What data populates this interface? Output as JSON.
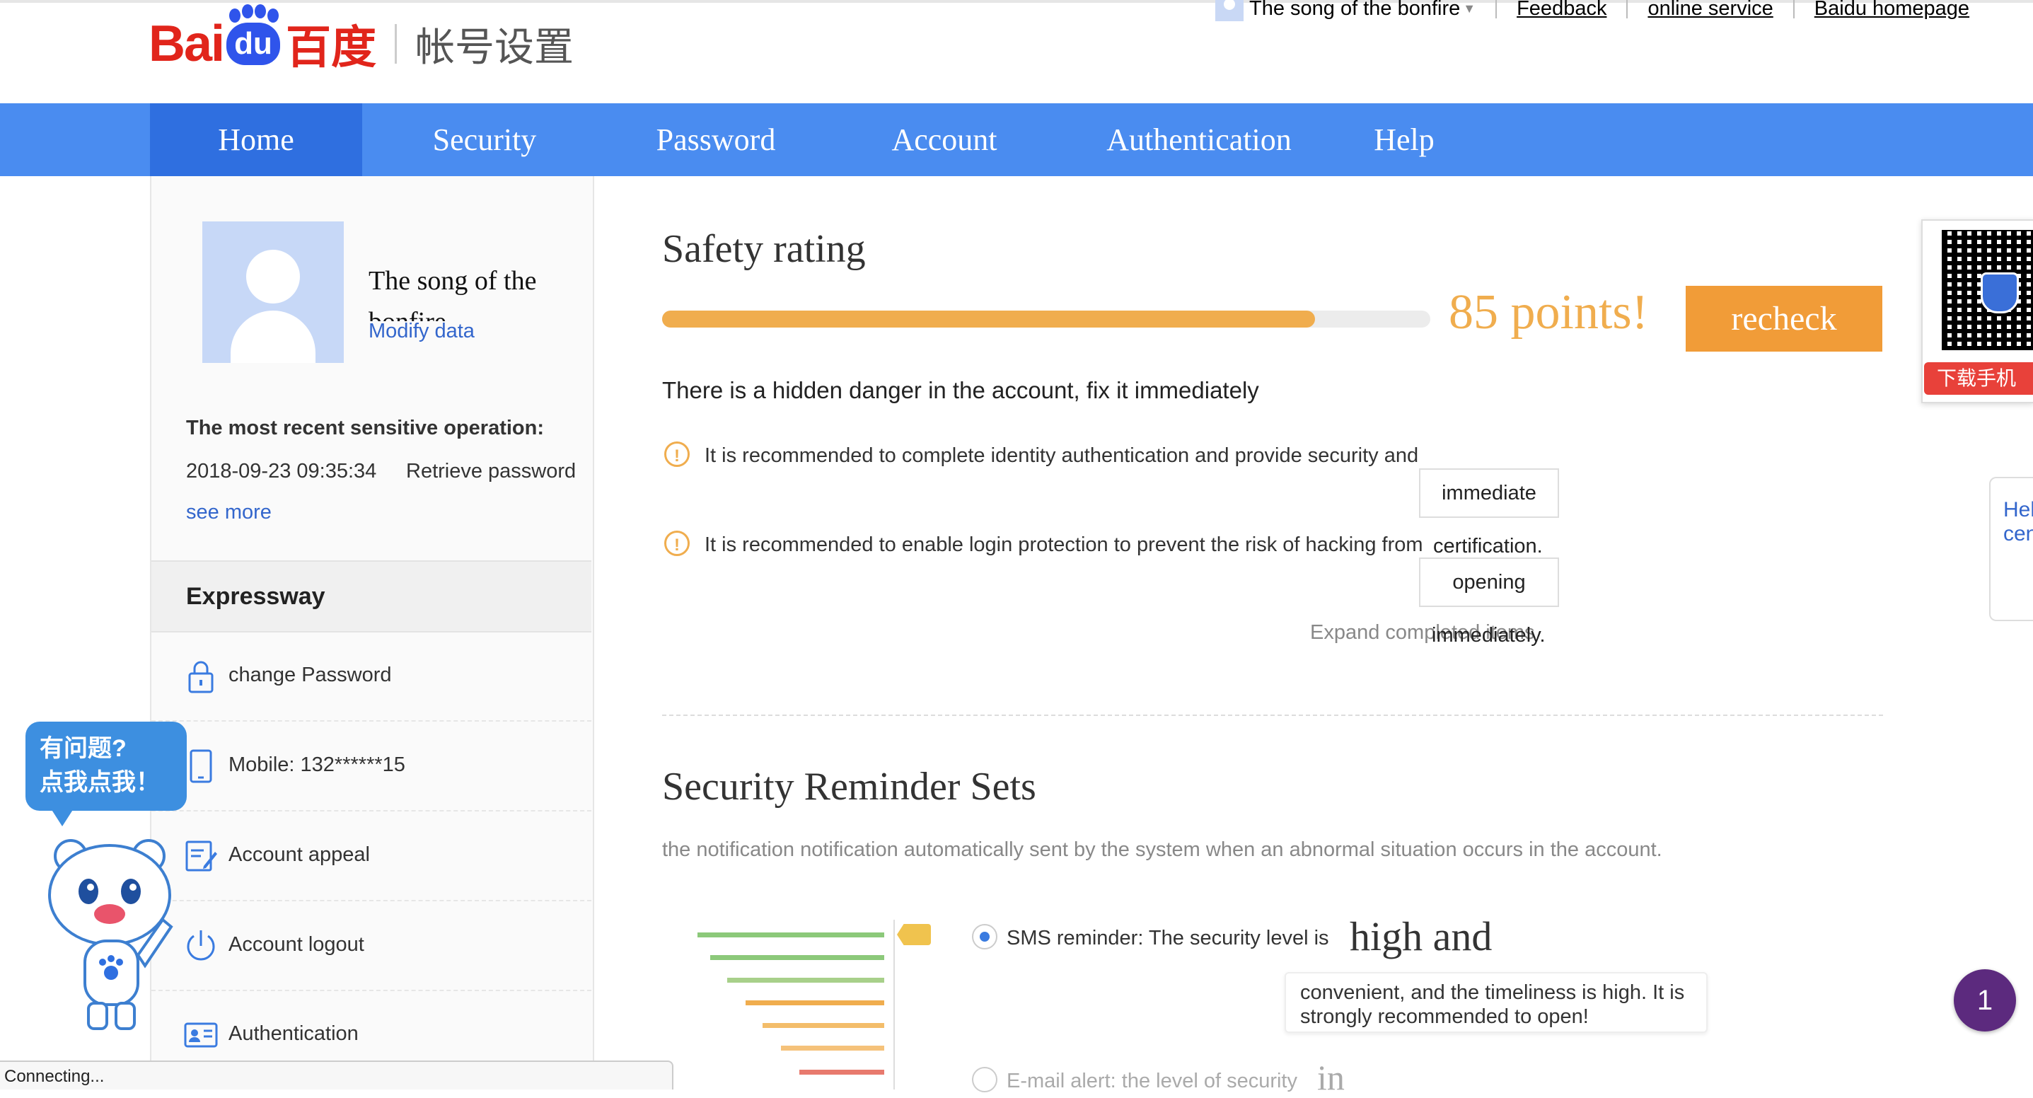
{
  "header": {
    "brand_red": "Bai",
    "brand_du": "du",
    "brand_cn": "百度",
    "page_title": "帐号设置",
    "user_name": "The song of the bonfire",
    "links": [
      "Feedback",
      "online service",
      "Baidu homepage"
    ]
  },
  "nav": {
    "items": [
      "Home",
      "Security",
      "Password",
      "Account",
      "Authentication",
      "Help"
    ],
    "active": "Home",
    "color": "#4a8cf0"
  },
  "profile": {
    "name": "The song of the bonfire",
    "modify_label": "Modify data",
    "recent_title": "The most recent sensitive operation:",
    "recent_time": "2018-09-23 09:35:34",
    "recent_action": "Retrieve password",
    "see_more": "see more"
  },
  "expressway": {
    "title": "Expressway",
    "items": [
      {
        "icon": "lock-icon",
        "label": "change Password"
      },
      {
        "icon": "mobile-icon",
        "label": "Mobile: 132******15"
      },
      {
        "icon": "edit-icon",
        "label": "Account appeal"
      },
      {
        "icon": "power-icon",
        "label": "Account logout"
      },
      {
        "icon": "id-card-icon",
        "label": "Authentication"
      }
    ]
  },
  "safety": {
    "title": "Safety rating",
    "score_fraction": 0.85,
    "score_text": "85 points!",
    "recheck_label": "recheck",
    "danger_text": "There is a hidden danger in the account, fix it immediately",
    "recommendations": [
      {
        "text": "It is recommended to complete identity authentication and provide security and",
        "button": "immediate",
        "overflow": "certification."
      },
      {
        "text": "It is recommended to enable login protection to prevent the risk of hacking from",
        "button": "opening",
        "overflow": "immediately."
      }
    ],
    "expand_label": "Expand completed items",
    "accent": "#f0ad4e"
  },
  "reminder": {
    "title": "Security Reminder Sets",
    "description": "the notification notification automatically sent by the system when an abnormal situation occurs in the account.",
    "sms_label": "SMS reminder: The security level is",
    "sms_big": "high and",
    "sms_tip": "convenient, and the timeliness is high. It is strongly recommended to open!",
    "email_label": "E-mail alert: the level of security",
    "email_big": "in"
  },
  "widgets": {
    "qr_download": "下载手机",
    "help_label": "Help center",
    "badge_count": "1",
    "mascot_bubble_line1": "有问题?",
    "mascot_bubble_line2": "点我点我！"
  },
  "status": {
    "text": "Connecting..."
  }
}
